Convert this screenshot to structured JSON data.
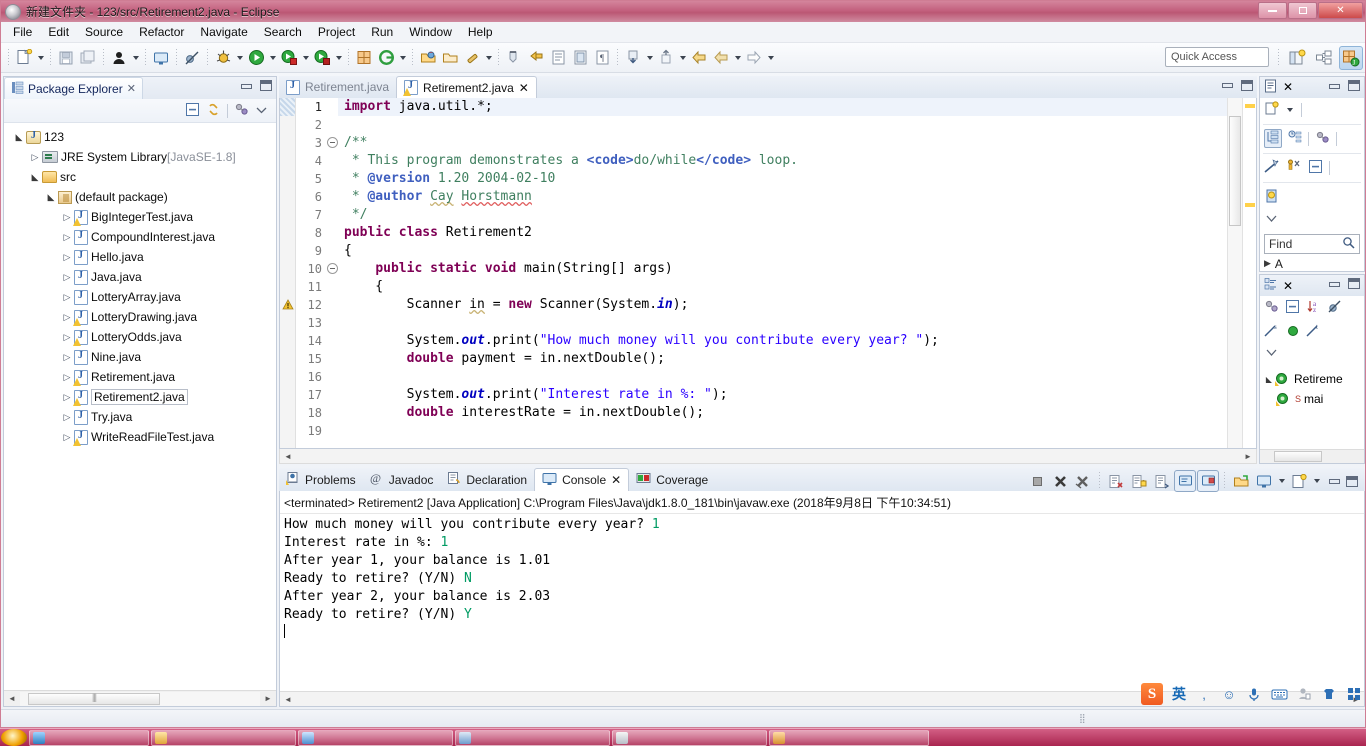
{
  "window": {
    "title": "新建文件夹 - 123/src/Retirement2.java - Eclipse",
    "minimize_label": "Minimize",
    "restore_label": "Restore",
    "close_label": "Close"
  },
  "menubar": {
    "items": [
      "File",
      "Edit",
      "Source",
      "Refactor",
      "Navigate",
      "Search",
      "Project",
      "Run",
      "Window",
      "Help"
    ]
  },
  "toolbar": {
    "quick_access_placeholder": "Quick Access",
    "icons": [
      "new-wizard-icon",
      "save-icon",
      "save-all-icon",
      "print-icon",
      "open-console-icon",
      "skip-breakpoints-icon",
      "debug-icon",
      "run-icon",
      "run-last-tool-icon",
      "external-tools-icon",
      "new-java-project-icon",
      "new-annotation-icon",
      "open-type-icon",
      "open-task-icon",
      "search-icon",
      "next-annotation-icon",
      "previous-annotation-icon",
      "last-edit-location-icon",
      "back-icon",
      "forward-icon"
    ],
    "perspective_buttons": [
      "open-perspective-icon",
      "resource-perspective-icon",
      "java-perspective-icon"
    ]
  },
  "package_explorer": {
    "tab_label": "Package Explorer",
    "toolbar_icons": [
      "collapse-all-icon",
      "link-with-editor-icon",
      "view-menu-focus-icon",
      "view-menu-icon"
    ],
    "tree": [
      {
        "label": "123",
        "indent": 0,
        "twisty": "open",
        "icon": "java-project-icon",
        "suffix": ""
      },
      {
        "label": "JRE System Library",
        "indent": 1,
        "twisty": "closed",
        "icon": "jre-library-icon",
        "suffix": " [JavaSE-1.8]"
      },
      {
        "label": "src",
        "indent": 1,
        "twisty": "open",
        "icon": "source-folder-icon",
        "suffix": ""
      },
      {
        "label": "(default package)",
        "indent": 2,
        "twisty": "open",
        "icon": "package-icon",
        "suffix": ""
      },
      {
        "label": "BigIntegerTest.java",
        "indent": 3,
        "twisty": "closed",
        "icon": "java-file-warning-icon",
        "suffix": ""
      },
      {
        "label": "CompoundInterest.java",
        "indent": 3,
        "twisty": "closed",
        "icon": "java-file-icon",
        "suffix": ""
      },
      {
        "label": "Hello.java",
        "indent": 3,
        "twisty": "closed",
        "icon": "java-file-icon",
        "suffix": ""
      },
      {
        "label": "Java.java",
        "indent": 3,
        "twisty": "closed",
        "icon": "java-file-icon",
        "suffix": ""
      },
      {
        "label": "LotteryArray.java",
        "indent": 3,
        "twisty": "closed",
        "icon": "java-file-icon",
        "suffix": ""
      },
      {
        "label": "LotteryDrawing.java",
        "indent": 3,
        "twisty": "closed",
        "icon": "java-file-warning-icon",
        "suffix": ""
      },
      {
        "label": "LotteryOdds.java",
        "indent": 3,
        "twisty": "closed",
        "icon": "java-file-warning-icon",
        "suffix": ""
      },
      {
        "label": "Nine.java",
        "indent": 3,
        "twisty": "closed",
        "icon": "java-file-icon",
        "suffix": ""
      },
      {
        "label": "Retirement.java",
        "indent": 3,
        "twisty": "closed",
        "icon": "java-file-warning-icon",
        "suffix": ""
      },
      {
        "label": "Retirement2.java",
        "indent": 3,
        "twisty": "closed",
        "icon": "java-file-warning-icon",
        "suffix": "",
        "selected": true
      },
      {
        "label": "Try.java",
        "indent": 3,
        "twisty": "closed",
        "icon": "java-file-icon",
        "suffix": ""
      },
      {
        "label": "WriteReadFileTest.java",
        "indent": 3,
        "twisty": "closed",
        "icon": "java-file-warning-icon",
        "suffix": ""
      }
    ]
  },
  "editor": {
    "tabs": [
      {
        "label": "Retirement.java",
        "active": false,
        "icon": "java-file-icon"
      },
      {
        "label": "Retirement2.java",
        "active": true,
        "icon": "java-file-warning-icon",
        "close": "✕"
      }
    ],
    "lines": [
      {
        "no": "1",
        "fold": "",
        "marker": "",
        "current": true,
        "parts": [
          {
            "t": "import ",
            "c": "kw"
          },
          {
            "t": "java.util.*;",
            "c": ""
          }
        ]
      },
      {
        "no": "2",
        "fold": "",
        "marker": "",
        "parts": []
      },
      {
        "no": "3",
        "fold": "collapse",
        "marker": "",
        "parts": [
          {
            "t": "/**",
            "c": "cmt"
          }
        ]
      },
      {
        "no": "4",
        "fold": "",
        "marker": "",
        "parts": [
          {
            "t": " * This program demonstrates a ",
            "c": "cmt"
          },
          {
            "t": "<code>",
            "c": "tag"
          },
          {
            "t": "do/while",
            "c": "cmt"
          },
          {
            "t": "</code>",
            "c": "tag"
          },
          {
            "t": " loop.",
            "c": "cmt"
          }
        ]
      },
      {
        "no": "5",
        "fold": "",
        "marker": "",
        "parts": [
          {
            "t": " * ",
            "c": "cmt"
          },
          {
            "t": "@version",
            "c": "tag"
          },
          {
            "t": " 1.20 2004-02-10",
            "c": "cmt"
          }
        ]
      },
      {
        "no": "6",
        "fold": "",
        "marker": "",
        "parts": [
          {
            "t": " * ",
            "c": "cmt"
          },
          {
            "t": "@author",
            "c": "tag"
          },
          {
            "t": " ",
            "c": "cmt"
          },
          {
            "t": "Cay",
            "c": "cmt spell"
          },
          {
            "t": " ",
            "c": "cmt"
          },
          {
            "t": "Horstmann",
            "c": "cmt spellr"
          }
        ]
      },
      {
        "no": "7",
        "fold": "",
        "marker": "",
        "parts": [
          {
            "t": " */",
            "c": "cmt"
          }
        ]
      },
      {
        "no": "8",
        "fold": "",
        "marker": "",
        "parts": [
          {
            "t": "public class ",
            "c": "kw"
          },
          {
            "t": "Retirement2",
            "c": ""
          }
        ]
      },
      {
        "no": "9",
        "fold": "",
        "marker": "",
        "parts": [
          {
            "t": "{",
            "c": ""
          }
        ]
      },
      {
        "no": "10",
        "fold": "collapse",
        "marker": "",
        "parts": [
          {
            "t": "    ",
            "c": ""
          },
          {
            "t": "public static void ",
            "c": "kw"
          },
          {
            "t": "main(String[] args)",
            "c": ""
          }
        ]
      },
      {
        "no": "11",
        "fold": "",
        "marker": "",
        "parts": [
          {
            "t": "    {",
            "c": ""
          }
        ]
      },
      {
        "no": "12",
        "fold": "",
        "marker": "warning",
        "parts": [
          {
            "t": "        Scanner ",
            "c": ""
          },
          {
            "t": "in",
            "c": "spell"
          },
          {
            "t": " = ",
            "c": ""
          },
          {
            "t": "new ",
            "c": "kw"
          },
          {
            "t": "Scanner(System.",
            "c": ""
          },
          {
            "t": "in",
            "c": "fld"
          },
          {
            "t": ");",
            "c": ""
          }
        ]
      },
      {
        "no": "13",
        "fold": "",
        "marker": "",
        "parts": []
      },
      {
        "no": "14",
        "fold": "",
        "marker": "",
        "parts": [
          {
            "t": "        System.",
            "c": ""
          },
          {
            "t": "out",
            "c": "fld"
          },
          {
            "t": ".print(",
            "c": ""
          },
          {
            "t": "\"How much money will you contribute every year? \"",
            "c": "str"
          },
          {
            "t": ");",
            "c": ""
          }
        ]
      },
      {
        "no": "15",
        "fold": "",
        "marker": "",
        "parts": [
          {
            "t": "        ",
            "c": ""
          },
          {
            "t": "double ",
            "c": "kw"
          },
          {
            "t": "payment = in.nextDouble();",
            "c": ""
          }
        ]
      },
      {
        "no": "16",
        "fold": "",
        "marker": "",
        "parts": []
      },
      {
        "no": "17",
        "fold": "",
        "marker": "",
        "parts": [
          {
            "t": "        System.",
            "c": ""
          },
          {
            "t": "out",
            "c": "fld"
          },
          {
            "t": ".print(",
            "c": ""
          },
          {
            "t": "\"Interest rate in %: \"",
            "c": "str"
          },
          {
            "t": ");",
            "c": ""
          }
        ]
      },
      {
        "no": "18",
        "fold": "",
        "marker": "",
        "parts": [
          {
            "t": "        ",
            "c": ""
          },
          {
            "t": "double ",
            "c": "kw"
          },
          {
            "t": "interestRate = in.nextDouble();",
            "c": ""
          }
        ]
      },
      {
        "no": "19",
        "fold": "",
        "marker": "",
        "parts": []
      }
    ]
  },
  "console": {
    "tabs": [
      {
        "label": "Problems",
        "icon": "problems-icon",
        "active": false
      },
      {
        "label": "Javadoc",
        "icon": "javadoc-icon",
        "active": false
      },
      {
        "label": "Declaration",
        "icon": "declaration-icon",
        "active": false
      },
      {
        "label": "Console",
        "icon": "console-icon",
        "active": true,
        "close": "✕"
      },
      {
        "label": "Coverage",
        "icon": "coverage-icon",
        "active": false
      }
    ],
    "toolbar_icons": [
      "terminate-icon",
      "remove-launch-icon",
      "remove-all-terminated-icon",
      "clear-console-icon",
      "scroll-lock-icon",
      "word-wrap-icon",
      "show-console-on-output-icon",
      "pin-console-icon",
      "display-selected-console-icon",
      "open-console-icon",
      "open-console-menu-icon",
      "new-console-view-icon",
      "new-console-menu-icon",
      "minimize-icon",
      "maximize-icon"
    ],
    "header": "<terminated> Retirement2 [Java Application] C:\\Program Files\\Java\\jdk1.8.0_181\\bin\\javaw.exe (2018年9月8日 下午10:34:51)",
    "output": [
      {
        "text": "How much money will you contribute every year? ",
        "input": "1"
      },
      {
        "text": "Interest rate in %: ",
        "input": "1"
      },
      {
        "text": "After year 1, your balance is 1.01",
        "input": ""
      },
      {
        "text": "Ready to retire? (Y/N) ",
        "input": "N"
      },
      {
        "text": "After year 2, your balance is 2.03",
        "input": ""
      },
      {
        "text": "Ready to retire? (Y/N) ",
        "input": "Y"
      }
    ]
  },
  "task_list": {
    "tab_label": "",
    "tab_icon": "task-list-icon",
    "toolbar_icons": [
      "new-task-icon",
      "new-task-menu-icon",
      "categorized-icon",
      "scheduled-icon",
      "presentation-icon",
      "focus-icon",
      "synchronize-icon",
      "collapse-all-icon",
      "task-repository-icon",
      "view-menu-icon"
    ],
    "find_label": "Find",
    "find_icon": "search-icon",
    "activate_label": "A"
  },
  "outline": {
    "tab_icon": "outline-icon",
    "toolbar_icons": [
      "focus-on-active-task-icon",
      "hide-fields-icon",
      "sort-icon",
      "hide-static-icon",
      "hide-non-public-icon",
      "hide-local-types-icon",
      "view-menu-icon"
    ],
    "items": [
      {
        "label": "Retireme",
        "icon": "class-icon",
        "indent": 0
      },
      {
        "label": "mai",
        "icon": "method-icon",
        "indent": 1,
        "badge": "S"
      }
    ]
  },
  "tray": {
    "icons": [
      "sogou-logo",
      "english-mode",
      "punctuation-icon",
      "emoji-icon",
      "voice-input-icon",
      "soft-keyboard-icon",
      "user-icon",
      "skin-icon",
      "toolbox-icon"
    ],
    "english_label": "英"
  },
  "colors": {
    "keyword": "#7f0055",
    "string": "#2a00ff",
    "comment": "#3f7f5f",
    "javadoc_tag": "#3f5fbf",
    "field": "#0000c0",
    "console_input": "#009b63",
    "title_bar": "#c3607e"
  }
}
